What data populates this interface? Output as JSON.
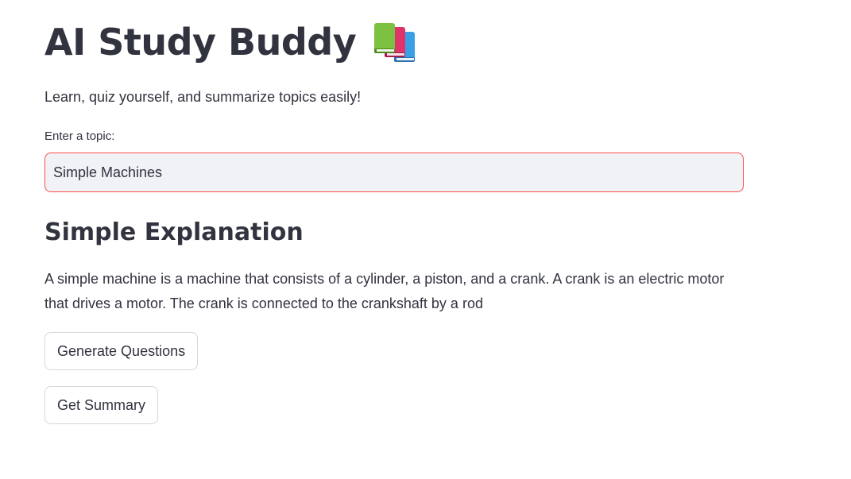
{
  "header": {
    "title": "AI Study Buddy",
    "icon": "books-icon"
  },
  "subtitle": "Learn, quiz yourself, and summarize topics easily!",
  "topic_field": {
    "label": "Enter a topic:",
    "value": "Simple Machines",
    "border_color": "#ff4b4b",
    "background_color": "#f0f2f6"
  },
  "explanation": {
    "heading": "Simple Explanation",
    "text": "A simple machine is a machine that consists of a cylinder, a piston, and a crank. A crank is an electric motor that drives a motor. The crank is connected to the crankshaft by a rod"
  },
  "buttons": {
    "generate_questions": "Generate Questions",
    "get_summary": "Get Summary"
  },
  "colors": {
    "text": "#31333f",
    "accent": "#ff4b4b"
  }
}
